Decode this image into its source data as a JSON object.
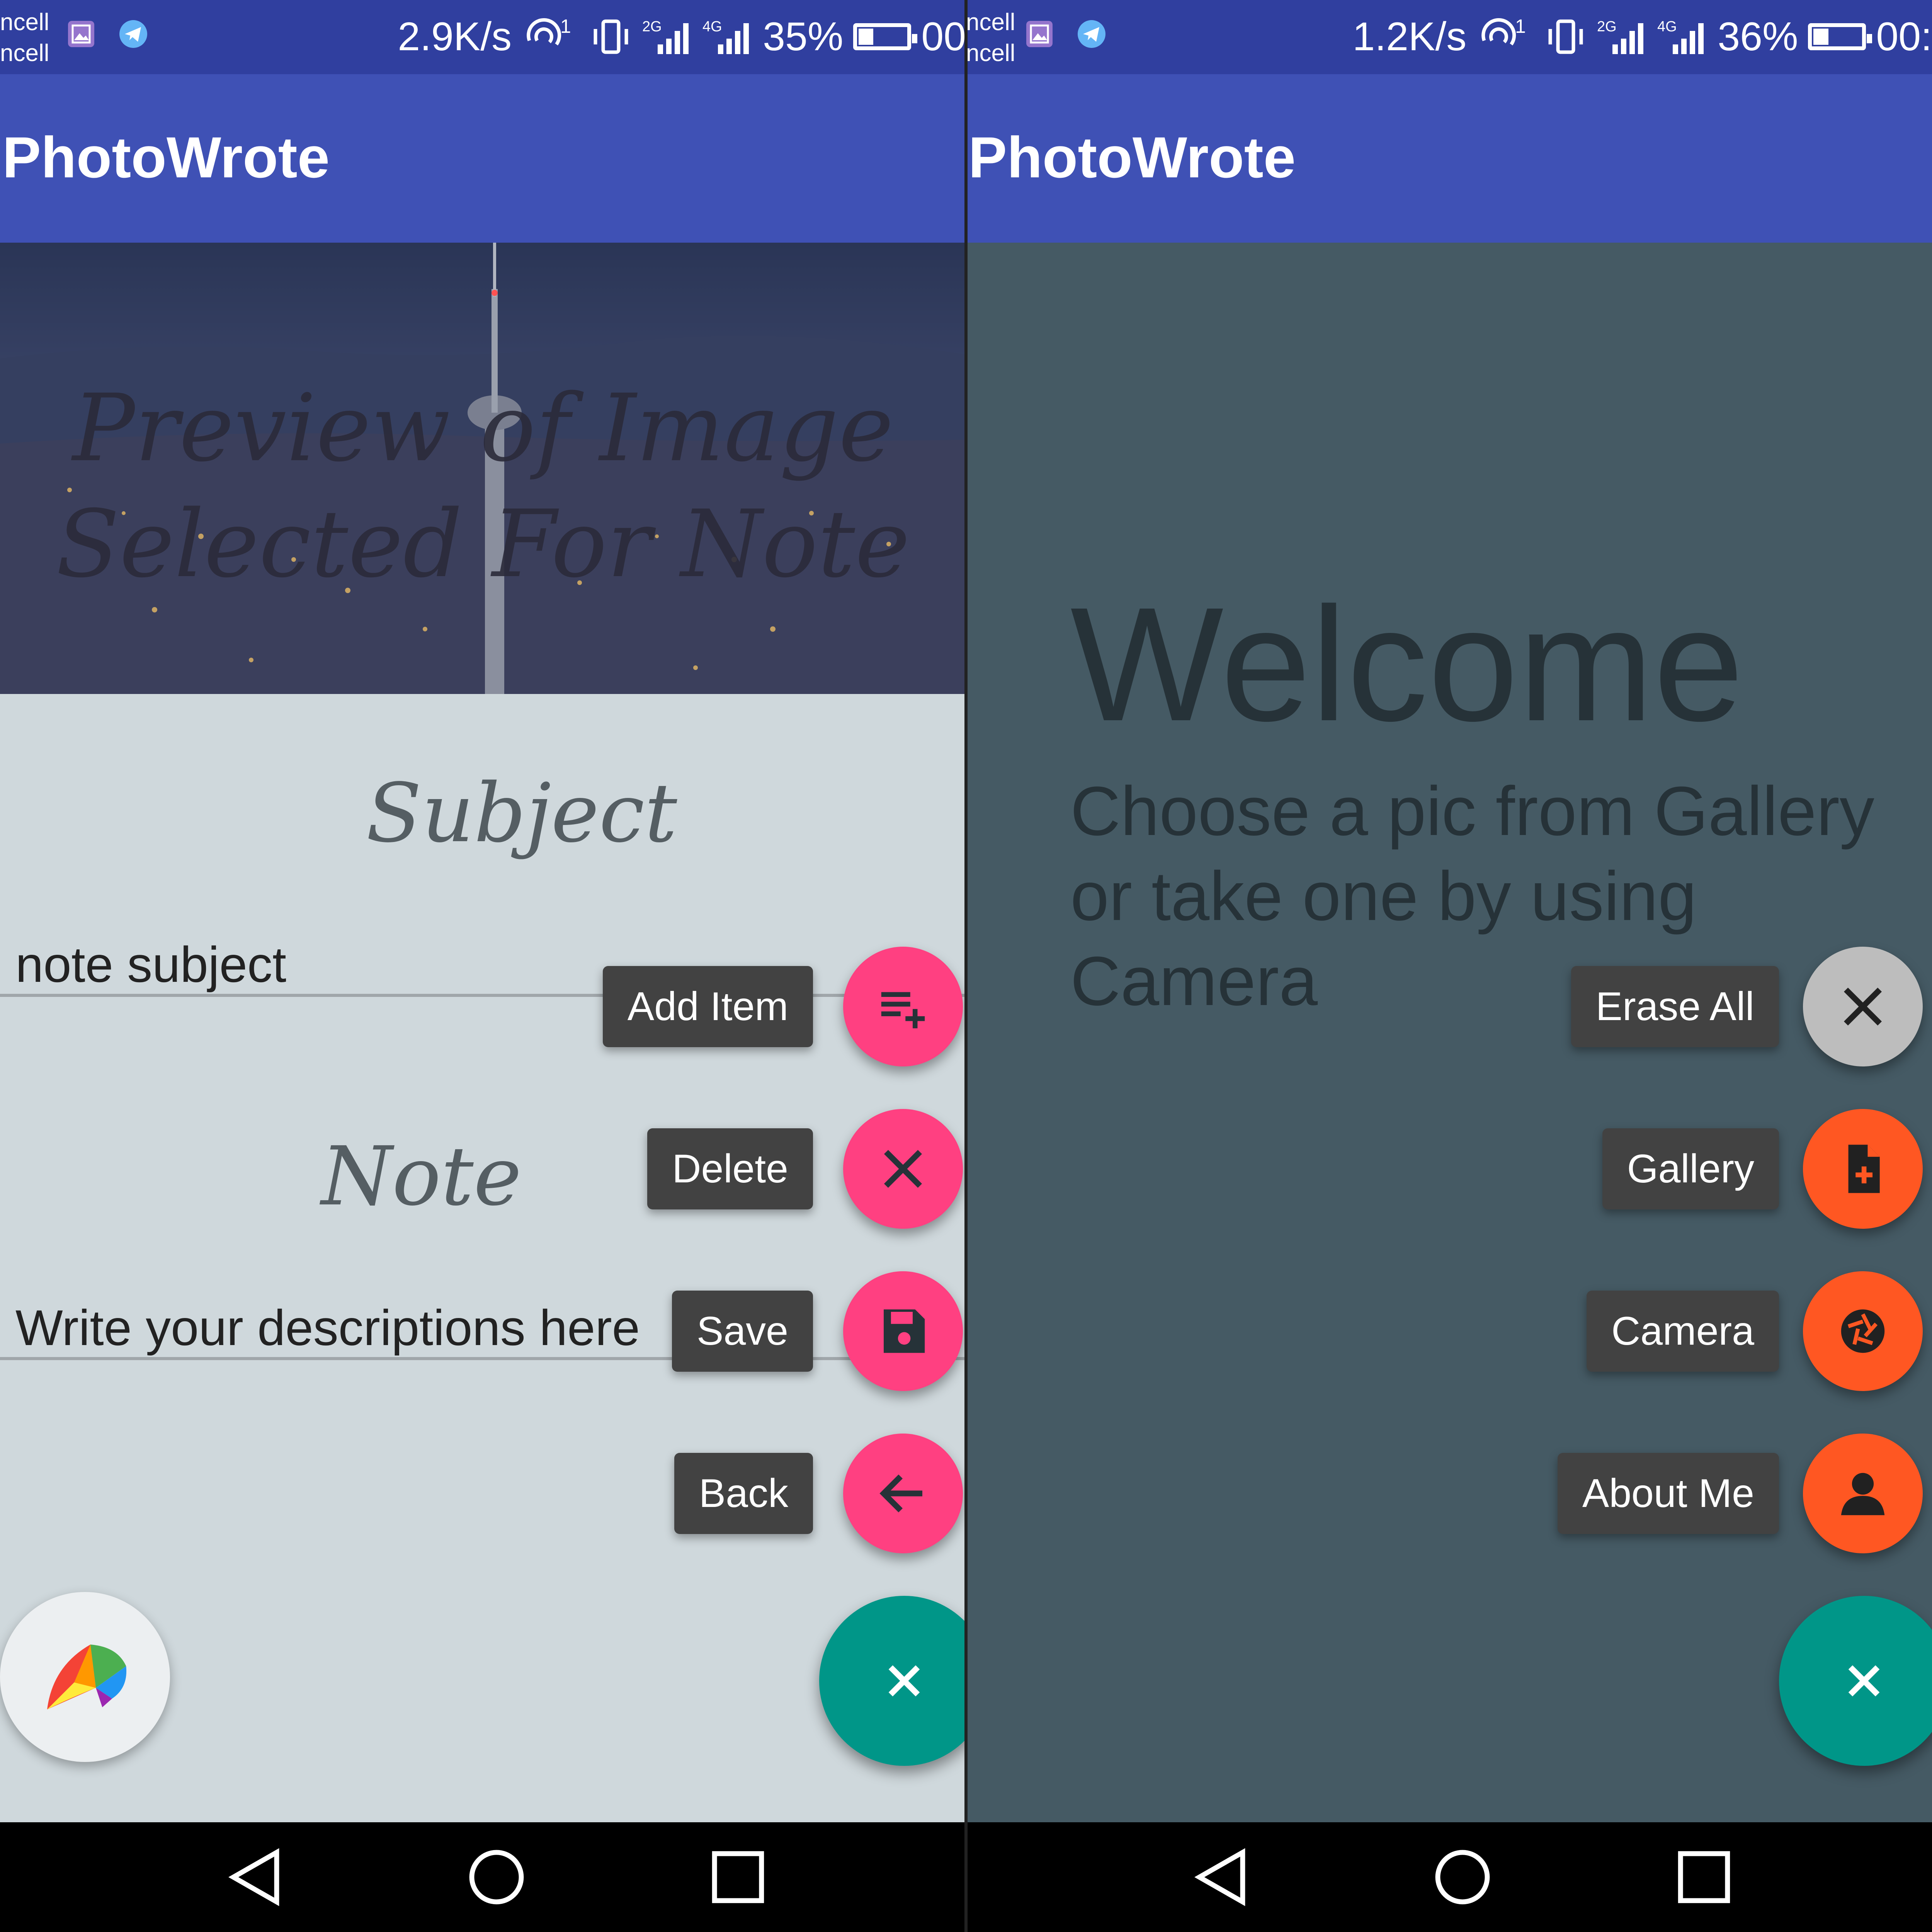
{
  "left": {
    "status": {
      "carrier_line1": "ncell",
      "carrier_line2": "ncell",
      "speed": "2.9K/s",
      "battery": "35%",
      "battery_level": 0.35,
      "time": "00",
      "network_2g": "2G",
      "network_4g": "4G"
    },
    "app_title": "PhotoWrote",
    "preview_text_line1": "Preview of Image",
    "preview_text_line2": "Selected For Note",
    "subject_label": "Subject",
    "subject_value": "note subject",
    "note_label": "Note",
    "note_placeholder": "Write your descriptions here",
    "fab_menu": [
      {
        "label": "Add Item",
        "icon": "playlist-add-icon"
      },
      {
        "label": "Delete",
        "icon": "close-icon"
      },
      {
        "label": "Save",
        "icon": "floppy-disk-icon"
      },
      {
        "label": "Back",
        "icon": "arrow-back-icon"
      }
    ],
    "main_fab_icon": "close-icon",
    "color_picker_icon": "rainbow-umbrella-icon"
  },
  "right": {
    "status": {
      "carrier_line1": "ncell",
      "carrier_line2": "ncell",
      "speed": "1.2K/s",
      "battery": "36%",
      "battery_level": 0.36,
      "time": "00:",
      "network_2g": "2G",
      "network_4g": "4G"
    },
    "app_title": "PhotoWrote",
    "welcome_title": "Welcome",
    "welcome_subtitle": "Choose a pic from Gallery or take one by using Camera",
    "fab_menu": [
      {
        "label": "Erase All",
        "icon": "close-icon"
      },
      {
        "label": "Gallery",
        "icon": "file-add-icon"
      },
      {
        "label": "Camera",
        "icon": "camera-shutter-icon"
      },
      {
        "label": "About Me",
        "icon": "person-icon"
      }
    ],
    "main_fab_icon": "close-icon"
  },
  "navigation": [
    "back-triangle-icon",
    "home-circle-icon",
    "recents-square-icon"
  ],
  "colors": {
    "status_bar": "#303f9f",
    "toolbar": "#3f51b5",
    "left_background": "#cfd8dc",
    "right_background": "#455a64",
    "pink_accent": "#ff4081",
    "orange_accent": "#ff5722",
    "teal_fab": "#009688",
    "grey_fab": "#bdbdbd",
    "label_chip": "#424242"
  }
}
